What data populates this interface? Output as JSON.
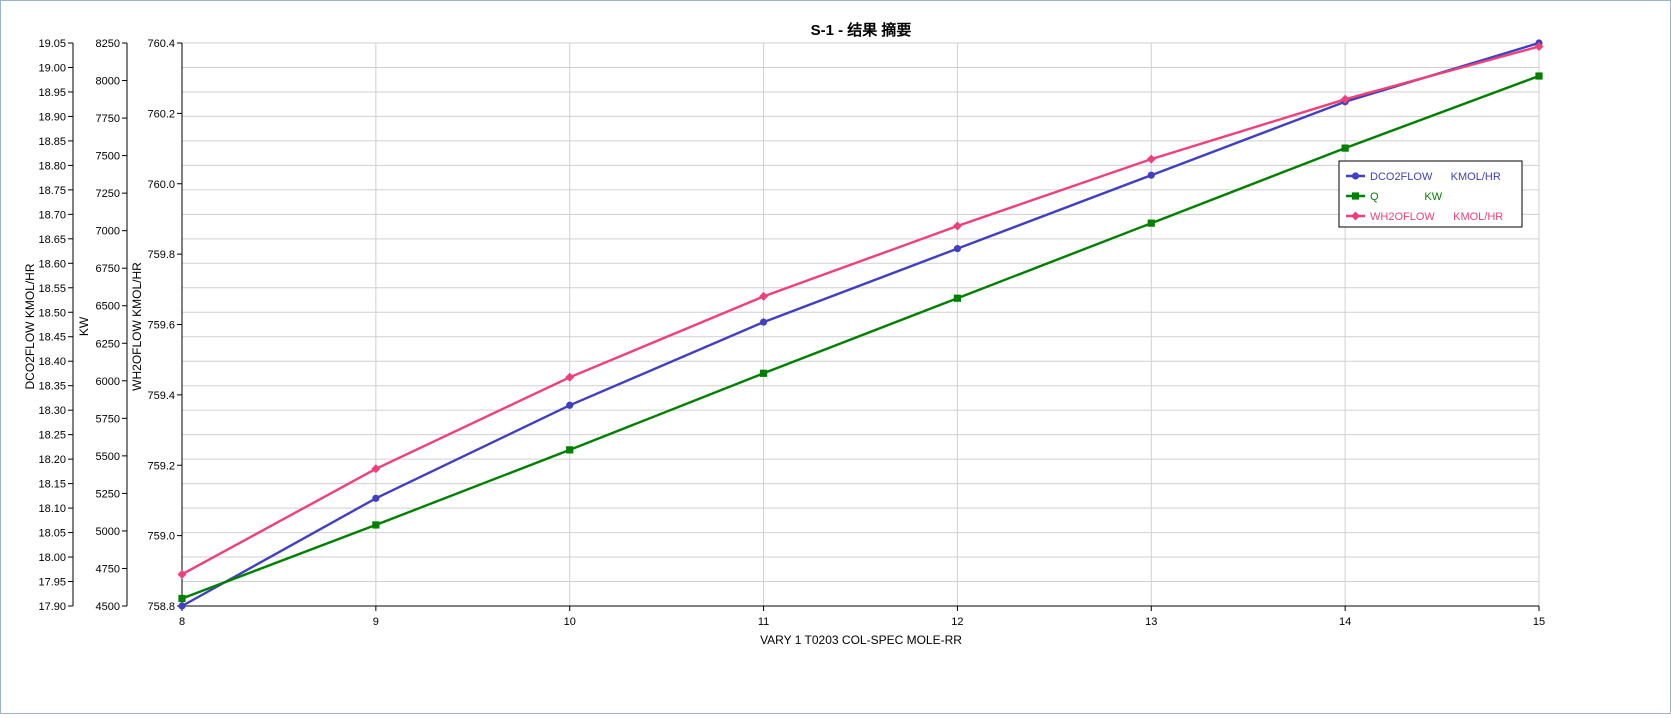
{
  "chart_data": {
    "type": "line",
    "title": "S-1 - 结果 摘要",
    "xlabel": "VARY   1 T0203     COL-SPEC MOLE-RR",
    "x": [
      8,
      9,
      10,
      11,
      12,
      13,
      14,
      15
    ],
    "xlim": [
      8,
      15
    ],
    "grid": true,
    "legend_position": "top-right",
    "axes": [
      {
        "id": "dco2",
        "label": "DCO2FLOW      KMOL/HR",
        "range": [
          17.9,
          19.05
        ],
        "ticks": [
          "17.90",
          "17.95",
          "18.00",
          "18.05",
          "18.10",
          "18.15",
          "18.20",
          "18.25",
          "18.30",
          "18.35",
          "18.40",
          "18.45",
          "18.50",
          "18.55",
          "18.60",
          "18.65",
          "18.70",
          "18.75",
          "18.80",
          "18.85",
          "18.90",
          "18.95",
          "19.00",
          "19.05"
        ]
      },
      {
        "id": "q",
        "label": "KW",
        "range": [
          4500,
          8250
        ],
        "ticks": [
          "4500",
          "4750",
          "5000",
          "5250",
          "5500",
          "5750",
          "6000",
          "6250",
          "6500",
          "6750",
          "7000",
          "7250",
          "7500",
          "7750",
          "8000",
          "8250"
        ]
      },
      {
        "id": "wh2o",
        "label": "WH2OFLOW      KMOL/HR",
        "range": [
          758.8,
          760.4
        ],
        "ticks": [
          "758.8",
          "759.0",
          "759.2",
          "759.4",
          "759.6",
          "759.8",
          "760.0",
          "760.2",
          "760.4"
        ]
      }
    ],
    "series": [
      {
        "name": "DCO2FLOW      KMOL/HR",
        "axis": "dco2",
        "color": "#4040c0",
        "marker": "circle",
        "values": [
          17.9,
          18.12,
          18.31,
          18.48,
          18.63,
          18.78,
          18.93,
          19.05
        ]
      },
      {
        "name": "Q               KW",
        "axis": "q",
        "color": "#008000",
        "marker": "square",
        "values": [
          4550,
          5040,
          5540,
          6050,
          6550,
          7050,
          7550,
          8030
        ]
      },
      {
        "name": "WH2OFLOW      KMOL/HR",
        "axis": "wh2o",
        "color": "#f0407a",
        "marker": "diamond",
        "values": [
          758.89,
          759.19,
          759.45,
          759.68,
          759.88,
          760.07,
          760.24,
          760.39
        ]
      }
    ]
  }
}
